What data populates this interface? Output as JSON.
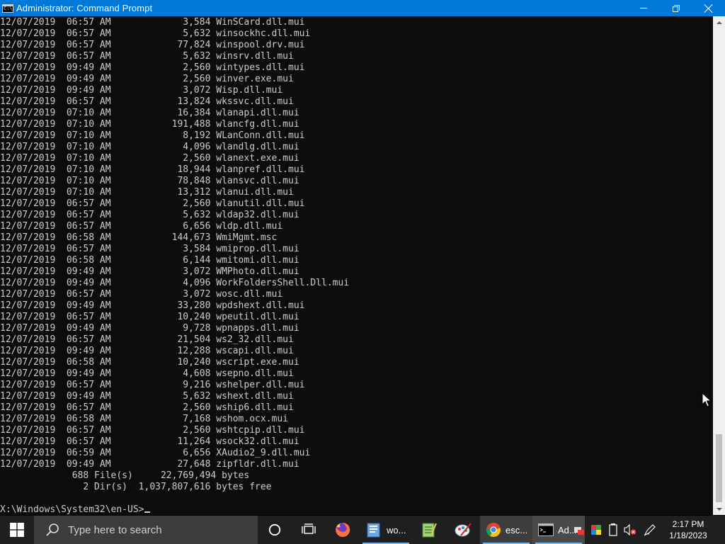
{
  "window": {
    "title": "Administrator: Command Prompt",
    "icon_text": "C:\\"
  },
  "console": {
    "lines": [
      "12/07/2019  06:57 AM             3,584 WinSCard.dll.mui",
      "12/07/2019  06:57 AM             5,632 winsockhc.dll.mui",
      "12/07/2019  06:57 AM            77,824 winspool.drv.mui",
      "12/07/2019  06:57 AM             5,632 winsrv.dll.mui",
      "12/07/2019  09:49 AM             2,560 wintypes.dll.mui",
      "12/07/2019  09:49 AM             2,560 winver.exe.mui",
      "12/07/2019  09:49 AM             3,072 Wisp.dll.mui",
      "12/07/2019  06:57 AM            13,824 wkssvc.dll.mui",
      "12/07/2019  07:10 AM            16,384 wlanapi.dll.mui",
      "12/07/2019  07:10 AM           191,488 wlancfg.dll.mui",
      "12/07/2019  07:10 AM             8,192 WLanConn.dll.mui",
      "12/07/2019  07:10 AM             4,096 wlandlg.dll.mui",
      "12/07/2019  07:10 AM             2,560 wlanext.exe.mui",
      "12/07/2019  07:10 AM            18,944 wlanpref.dll.mui",
      "12/07/2019  07:10 AM            78,848 wlansvc.dll.mui",
      "12/07/2019  07:10 AM            13,312 wlanui.dll.mui",
      "12/07/2019  06:57 AM             2,560 wlanutil.dll.mui",
      "12/07/2019  06:57 AM             5,632 wldap32.dll.mui",
      "12/07/2019  06:57 AM             6,656 wldp.dll.mui",
      "12/07/2019  06:58 AM           144,673 WmiMgmt.msc",
      "12/07/2019  06:57 AM             3,584 wmiprop.dll.mui",
      "12/07/2019  06:58 AM             6,144 wmitomi.dll.mui",
      "12/07/2019  09:49 AM             3,072 WMPhoto.dll.mui",
      "12/07/2019  09:49 AM             4,096 WorkFoldersShell.Dll.mui",
      "12/07/2019  06:57 AM             3,072 wosc.dll.mui",
      "12/07/2019  09:49 AM            33,280 wpdshext.dll.mui",
      "12/07/2019  06:57 AM            10,240 wpeutil.dll.mui",
      "12/07/2019  09:49 AM             9,728 wpnapps.dll.mui",
      "12/07/2019  06:57 AM            21,504 ws2_32.dll.mui",
      "12/07/2019  09:49 AM            12,288 wscapi.dll.mui",
      "12/07/2019  06:58 AM            10,240 wscript.exe.mui",
      "12/07/2019  09:49 AM             4,608 wsepno.dll.mui",
      "12/07/2019  06:57 AM             9,216 wshelper.dll.mui",
      "12/07/2019  09:49 AM             5,632 wshext.dll.mui",
      "12/07/2019  06:57 AM             2,560 wship6.dll.mui",
      "12/07/2019  06:58 AM             7,168 wshom.ocx.mui",
      "12/07/2019  06:57 AM             2,560 wshtcpip.dll.mui",
      "12/07/2019  06:57 AM            11,264 wsock32.dll.mui",
      "12/07/2019  06:59 AM             6,656 XAudio2_9.dll.mui",
      "12/07/2019  09:49 AM            27,648 zipfldr.dll.mui"
    ],
    "summary_files": "             688 File(s)     22,769,494 bytes",
    "summary_dirs": "               2 Dir(s)  1,037,807,616 bytes free",
    "prompt": "X:\\Windows\\System32\\en-US>"
  },
  "taskbar": {
    "search_placeholder": "Type here to search",
    "apps": [
      {
        "label": "wo...",
        "icon": "wordpad-icon"
      },
      {
        "label": "esc...",
        "icon": "chrome-icon"
      },
      {
        "label": "Ad...",
        "icon": "cmd-icon"
      }
    ],
    "clock_time": "2:17 PM",
    "clock_date": "1/18/2023"
  },
  "colors": {
    "titlebar": "#0078d7",
    "console_bg": "#0c0c0c",
    "console_text": "#cccccc",
    "taskbar": "#1f1f1f",
    "search_bg": "#3c3c3c"
  }
}
